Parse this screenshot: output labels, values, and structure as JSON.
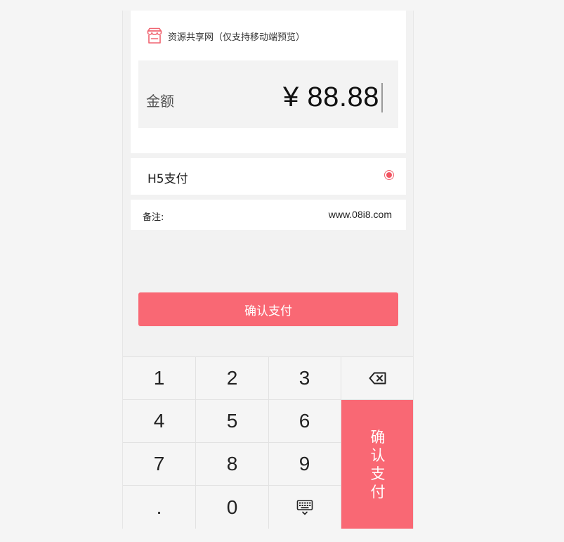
{
  "header": {
    "brand_text": "资源共享网（仅支持移动端预览）",
    "brand_icon": "store-icon",
    "brand_color": "#f06470"
  },
  "amount": {
    "label": "金额",
    "value": "¥ 88.88"
  },
  "payment": {
    "method_label": "H5支付",
    "selected": true
  },
  "note": {
    "label": "备注:",
    "value": "www.08i8.com"
  },
  "actions": {
    "confirm_label": "确认支付"
  },
  "keypad": {
    "keys": [
      "1",
      "2",
      "3",
      "4",
      "5",
      "6",
      "7",
      "8",
      "9",
      ".",
      "0"
    ],
    "backspace_icon": "backspace-icon",
    "hide_keyboard_icon": "keyboard-hide-icon",
    "confirm_chars": [
      "确",
      "认",
      "支",
      "付"
    ]
  },
  "colors": {
    "accent": "#f96874",
    "background": "#f2f2f2"
  }
}
